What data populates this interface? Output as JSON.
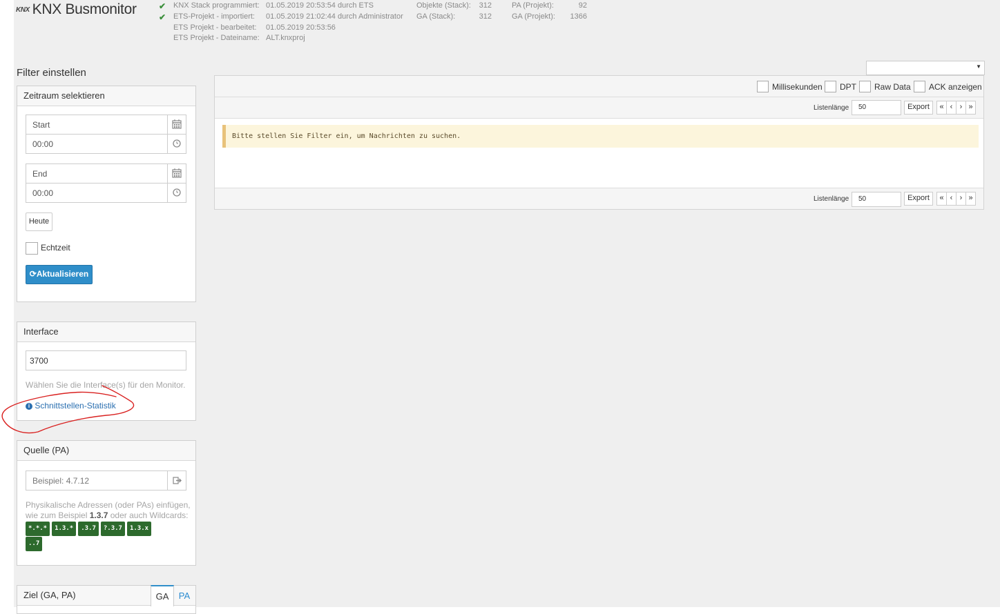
{
  "app": {
    "logo": "KNX",
    "title": "KNX Busmonitor"
  },
  "header": {
    "info": [
      {
        "check": true,
        "label": "KNX Stack programmiert:",
        "value": "01.05.2019 20:53:54 durch ETS"
      },
      {
        "check": true,
        "label": "ETS-Projekt - importiert:",
        "value": "01.05.2019 21:02:44 durch Administrator"
      },
      {
        "check": false,
        "label": "ETS Projekt - bearbeitet:",
        "value": "01.05.2019 20:53:56"
      },
      {
        "check": false,
        "label": "ETS Projekt - Dateiname:",
        "value": "ALT.knxproj"
      }
    ],
    "stats": [
      {
        "label": "Objekte (Stack):",
        "value": "312"
      },
      {
        "label": "GA (Stack):",
        "value": "312"
      },
      {
        "label": "PA (Projekt):",
        "value": "92"
      },
      {
        "label": "GA (Projekt):",
        "value": "1366"
      }
    ]
  },
  "filter": {
    "title": "Filter einstellen",
    "timerange": {
      "heading": "Zeitraum selektieren",
      "start_placeholder": "Start",
      "start_time": "00:00",
      "end_placeholder": "End",
      "end_time": "00:00",
      "today_label": "Heute",
      "realtime_label": "Echtzeit",
      "refresh_label": "Aktualisieren"
    },
    "interface": {
      "heading": "Interface",
      "value": "3700",
      "help": "Wählen Sie die Interface(s) für den Monitor.",
      "link": "Schnittstellen-Statistik"
    },
    "source": {
      "heading": "Quelle (PA)",
      "placeholder": "Beispiel: 4.7.12",
      "help_line1": "Physikalische Adressen (oder PAs) einfügen,",
      "help_line2_pre": "wie zum Beispiel ",
      "help_line2_bold": "1.3.7",
      "help_line2_post": " oder auch Wildcards:",
      "wildcards": [
        "*.*.*",
        "1.3.*",
        ".3.7",
        "?.3.7",
        "1.3.x",
        "..7"
      ]
    },
    "target": {
      "heading": "Ziel (GA, PA)",
      "tabs": [
        "GA",
        "PA"
      ]
    }
  },
  "main": {
    "options": [
      "Millisekunden",
      "DPT",
      "Raw Data",
      "ACK anzeigen"
    ],
    "pager": {
      "length_label": "Listenlänge",
      "length_value": "50",
      "export_label": "Export",
      "buttons": [
        "«",
        "‹",
        "›",
        "»"
      ]
    },
    "message": "Bitte stellen Sie Filter ein, um Nachrichten zu suchen."
  },
  "colors": {
    "primary": "#2f8ec9",
    "badge": "#2d6a2d",
    "alert_bg": "#fcf5dc",
    "alert_border": "#e8c27a",
    "annotation": "#d9201f",
    "link": "#2a6fb0"
  }
}
